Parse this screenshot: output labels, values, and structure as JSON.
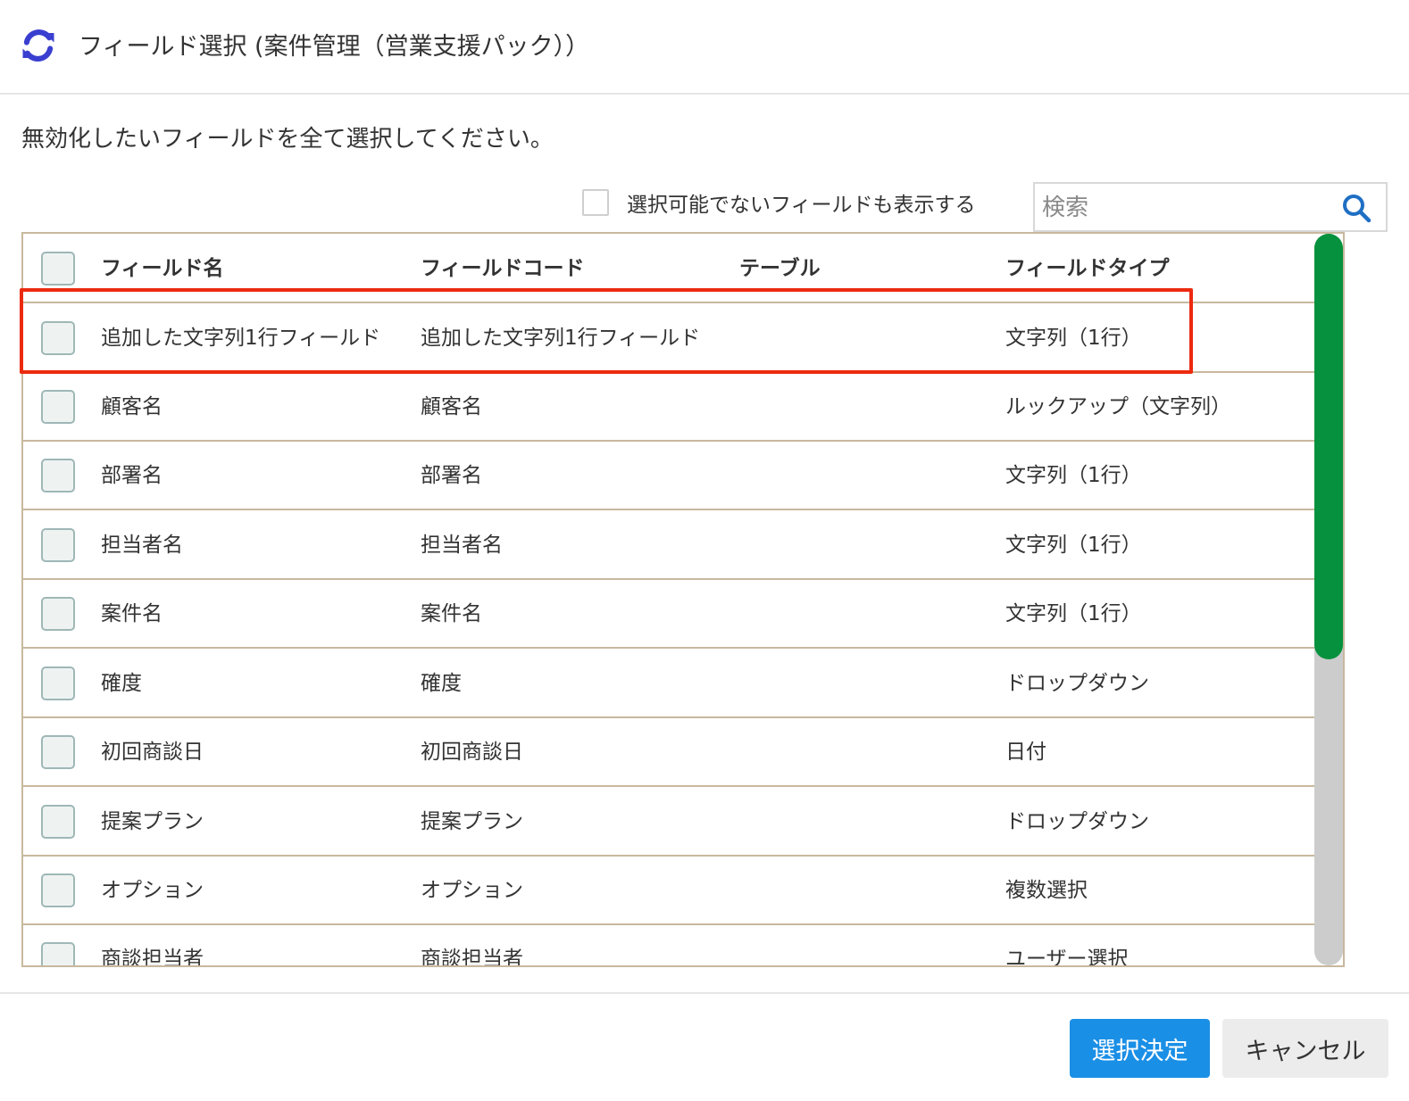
{
  "header": {
    "title": "フィールド選択 (案件管理（営業支援パック））",
    "icon": "refresh-icon",
    "icon_color": "#3a3fd0"
  },
  "instruction": "無効化したいフィールドを全て選択してください。",
  "show_unselectable": {
    "label": "選択可能でないフィールドも表示する",
    "checked": false
  },
  "search": {
    "placeholder": "検索",
    "value": "",
    "icon": "search-icon",
    "icon_color": "#1f6fc4"
  },
  "table": {
    "columns": [
      "フィールド名",
      "フィールドコード",
      "テーブル",
      "フィールドタイプ"
    ],
    "rows": [
      {
        "name": "追加した文字列1行フィールド",
        "code": "追加した文字列1行フィールド",
        "table": "",
        "type": "文字列（1行）",
        "highlighted": true
      },
      {
        "name": "顧客名",
        "code": "顧客名",
        "table": "",
        "type": "ルックアップ（文字列）"
      },
      {
        "name": "部署名",
        "code": "部署名",
        "table": "",
        "type": "文字列（1行）"
      },
      {
        "name": "担当者名",
        "code": "担当者名",
        "table": "",
        "type": "文字列（1行）"
      },
      {
        "name": "案件名",
        "code": "案件名",
        "table": "",
        "type": "文字列（1行）"
      },
      {
        "name": "確度",
        "code": "確度",
        "table": "",
        "type": "ドロップダウン"
      },
      {
        "name": "初回商談日",
        "code": "初回商談日",
        "table": "",
        "type": "日付"
      },
      {
        "name": "提案プラン",
        "code": "提案プラン",
        "table": "",
        "type": "ドロップダウン"
      },
      {
        "name": "オプション",
        "code": "オプション",
        "table": "",
        "type": "複数選択"
      },
      {
        "name": "商談担当者",
        "code": "商談担当者",
        "table": "",
        "type": "ユーザー選択"
      }
    ]
  },
  "footer": {
    "confirm_label": "選択決定",
    "cancel_label": "キャンセル"
  },
  "colors": {
    "primary": "#1a8fe6",
    "scroll_thumb": "#05913d",
    "highlight": "#ec2a0f",
    "table_border": "#c8b89e"
  }
}
